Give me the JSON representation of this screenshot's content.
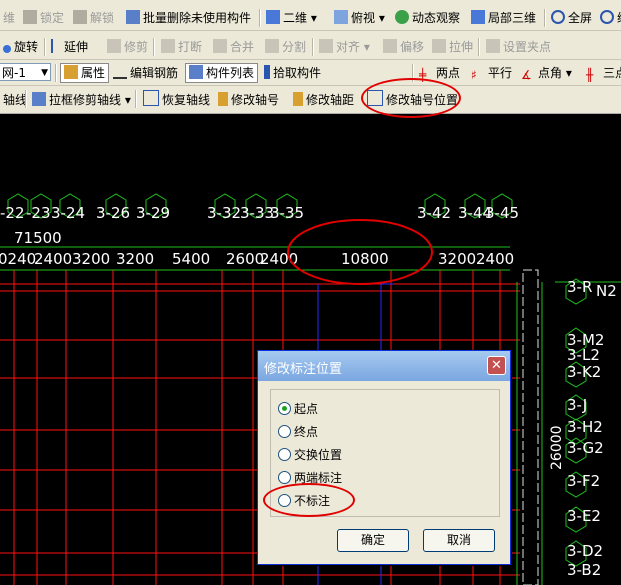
{
  "toolbar": {
    "row1": {
      "frag": "维",
      "lock": "锁定",
      "unlock": "解锁",
      "batch_delete": "批量删除未使用构件",
      "view2d": "二维",
      "topview": "俯视",
      "dynamic": "动态观察",
      "local3d": "局部三维",
      "fullscreen": "全屏",
      "zoomout": "缩"
    },
    "row2": {
      "rotate": "旋转",
      "extend": "延伸",
      "trim": "修剪",
      "break": "打断",
      "merge": "合并",
      "split": "分割",
      "align": "对齐",
      "offset": "偏移",
      "stretch": "拉伸",
      "setgrip": "设置夹点"
    },
    "row3": {
      "combo_value": "网-1",
      "properties": "属性",
      "edit_rebar": "编辑钢筋",
      "component_list": "构件列表",
      "pick": "拾取构件",
      "two_points": "两点",
      "parallel": "平行",
      "point_angle": "点角",
      "three_points": "三点"
    },
    "row4": {
      "axis": "轴线",
      "box_trim": "拉框修剪轴线",
      "restore": "恢复轴线",
      "modify_label": "修改轴号",
      "modify_spacing": "修改轴距",
      "modify_position": "修改轴号位置"
    }
  },
  "cad": {
    "top_axes": [
      "-22",
      "-23",
      "3-24",
      "3-26",
      "3-29",
      "3-32",
      "3-33",
      "3-35",
      "3-42",
      "3-44",
      "3-45"
    ],
    "total_dim": "71500",
    "dims": [
      "0240",
      "2400",
      "3200",
      "3200",
      "5400",
      "2600",
      "2400",
      "10800",
      "3200",
      "2400"
    ],
    "right_axes": [
      "3-R",
      "N2",
      "3-M2",
      "3-L2",
      "3-K2",
      "3-J",
      "3-H2",
      "3-G2",
      "3-F2",
      "3-E2",
      "3-D2",
      "3-B2"
    ],
    "right_total_dim": "26000"
  },
  "dialog": {
    "title": "修改标注位置",
    "options": [
      "起点",
      "终点",
      "交换位置",
      "两端标注",
      "不标注"
    ],
    "selected": 0,
    "ok": "确定",
    "cancel": "取消"
  }
}
